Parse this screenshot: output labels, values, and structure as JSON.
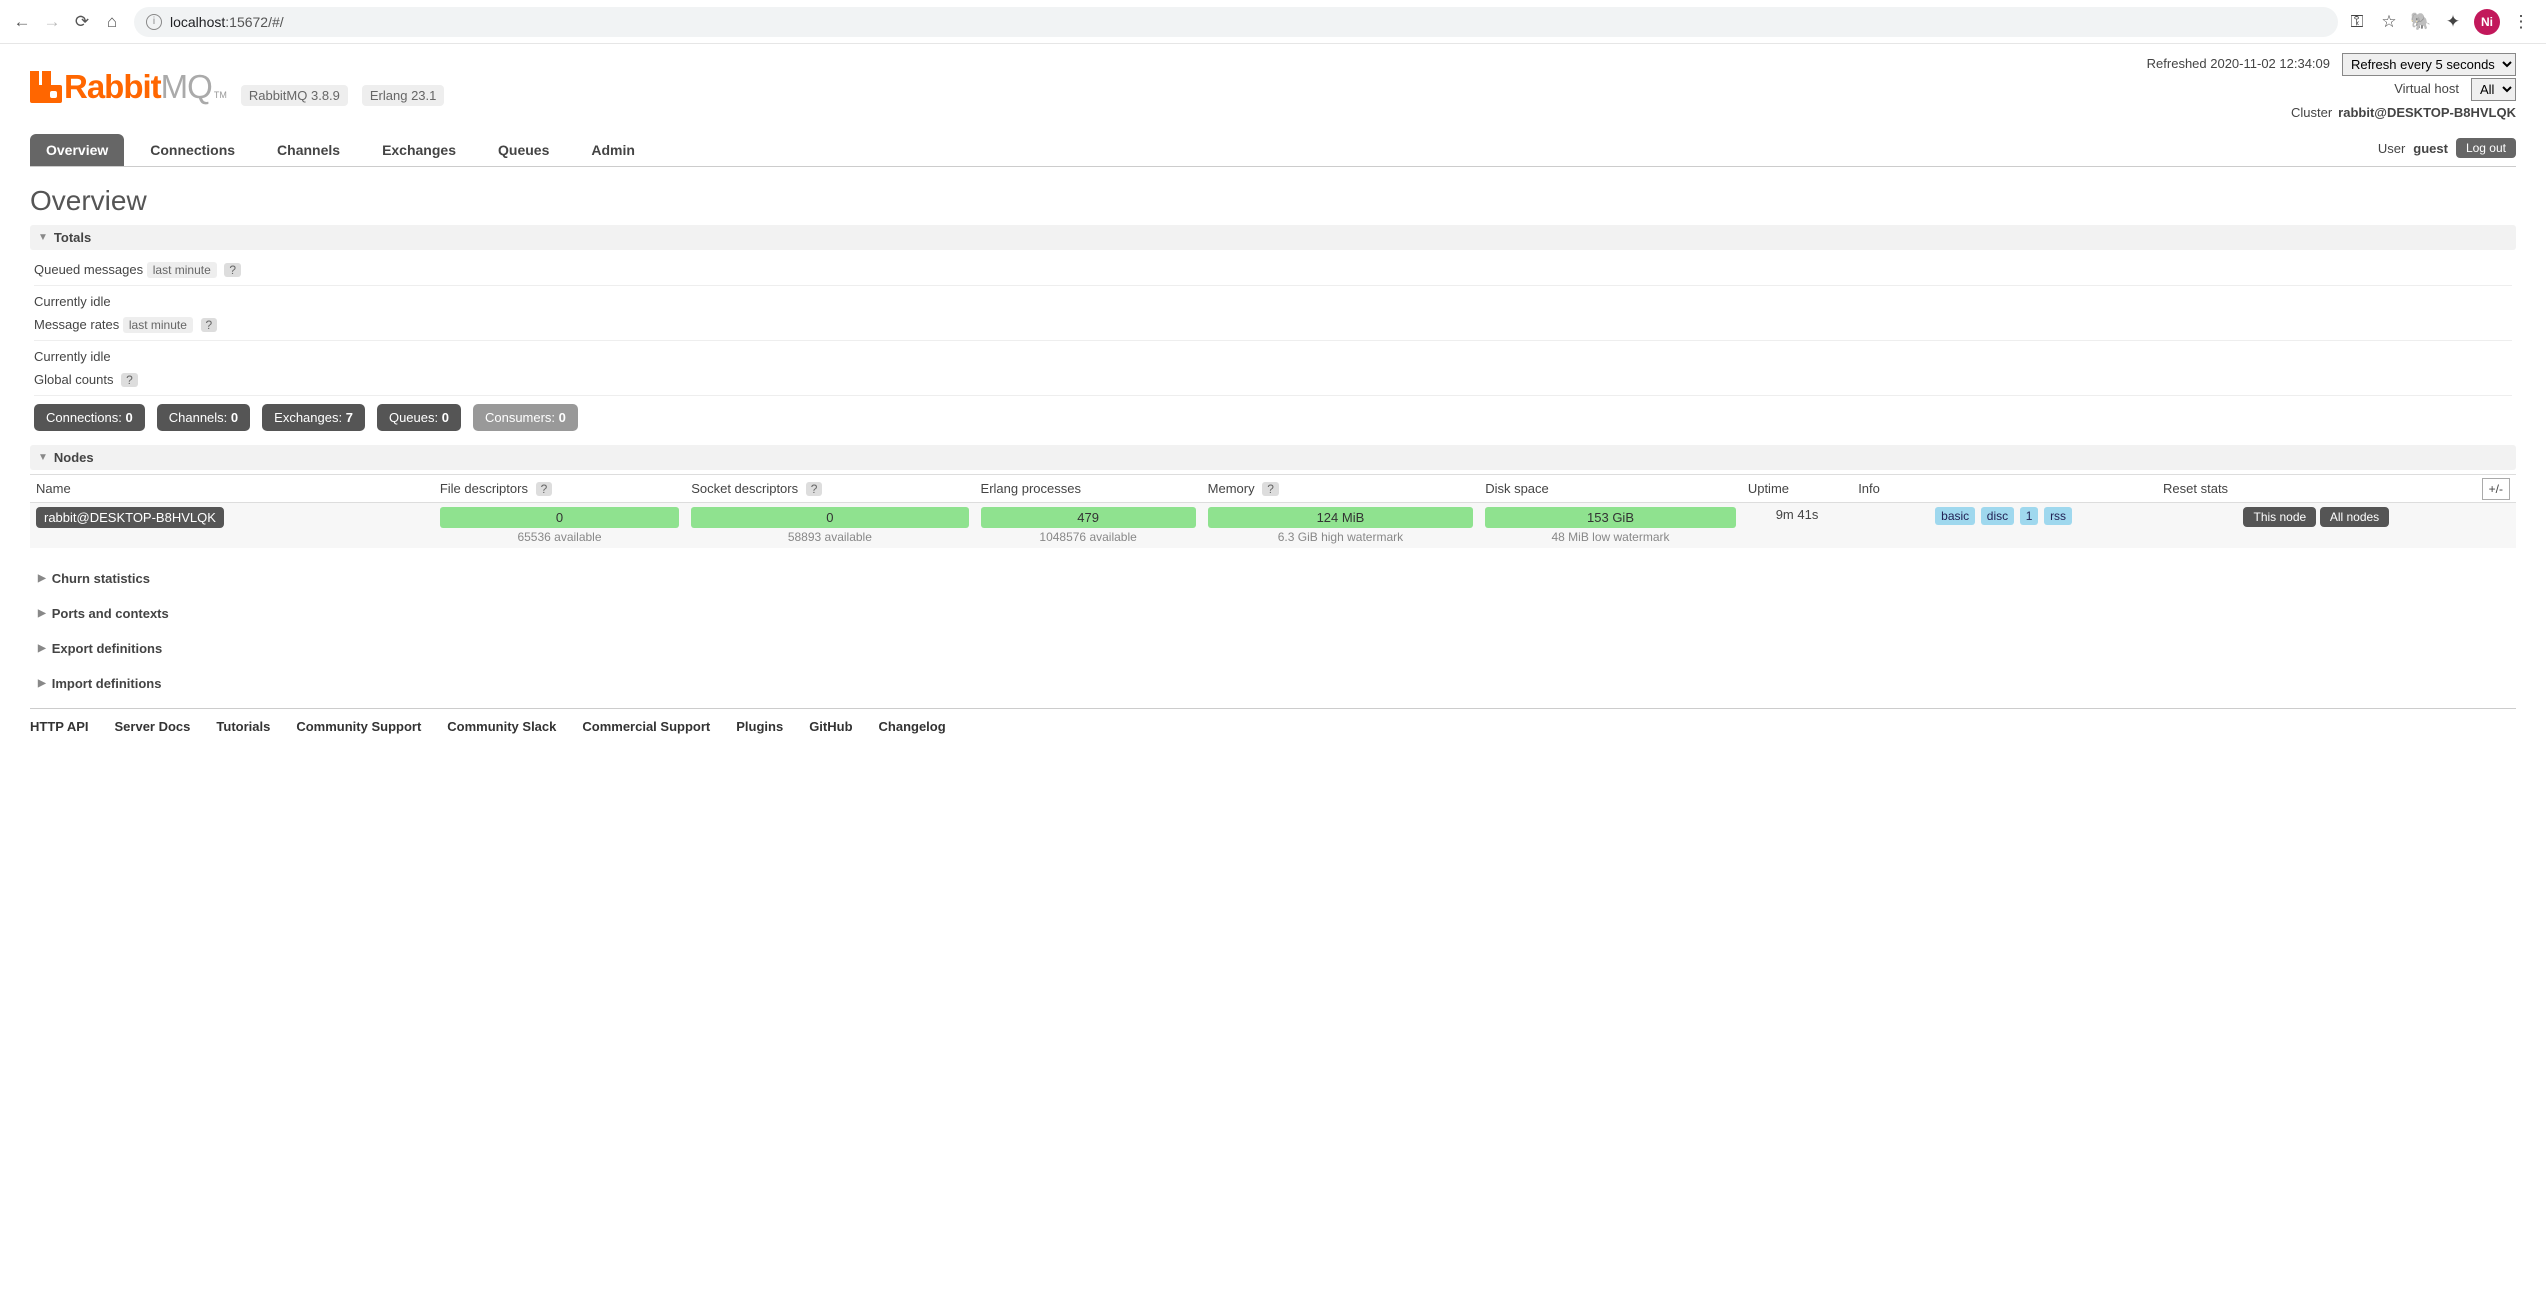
{
  "browser": {
    "url_host": "localhost",
    "url_rest": ":15672/#/",
    "avatar_initials": "Ni"
  },
  "header": {
    "logo_orange": "Rabbit",
    "logo_grey": "MQ",
    "tm": "TM",
    "version_rmq": "RabbitMQ 3.8.9",
    "version_erlang": "Erlang 23.1",
    "refreshed_label": "Refreshed 2020-11-02 12:34:09",
    "refresh_select": "Refresh every 5 seconds",
    "vhost_label": "Virtual host",
    "vhost_value": "All",
    "cluster_label": "Cluster",
    "cluster_name": "rabbit@DESKTOP-B8HVLQK",
    "user_label": "User",
    "user_name": "guest",
    "logout": "Log out"
  },
  "tabs": [
    "Overview",
    "Connections",
    "Channels",
    "Exchanges",
    "Queues",
    "Admin"
  ],
  "page_title": "Overview",
  "totals": {
    "title": "Totals",
    "queued_label": "Queued messages",
    "queued_range": "last minute",
    "idle1": "Currently idle",
    "rates_label": "Message rates",
    "rates_range": "last minute",
    "idle2": "Currently idle",
    "global_label": "Global counts"
  },
  "counts": [
    {
      "label": "Connections:",
      "value": "0",
      "light": false
    },
    {
      "label": "Channels:",
      "value": "0",
      "light": false
    },
    {
      "label": "Exchanges:",
      "value": "7",
      "light": false
    },
    {
      "label": "Queues:",
      "value": "0",
      "light": false
    },
    {
      "label": "Consumers:",
      "value": "0",
      "light": true
    }
  ],
  "nodes": {
    "title": "Nodes",
    "columns": [
      "Name",
      "File descriptors",
      "Socket descriptors",
      "Erlang processes",
      "Memory",
      "Disk space",
      "Uptime",
      "Info",
      "Reset stats",
      "+/-"
    ],
    "row": {
      "name": "rabbit@DESKTOP-B8HVLQK",
      "fd": "0",
      "fd_sub": "65536 available",
      "sd": "0",
      "sd_sub": "58893 available",
      "ep": "479",
      "ep_sub": "1048576 available",
      "mem": "124 MiB",
      "mem_sub": "6.3 GiB high watermark",
      "disk": "153 GiB",
      "disk_sub": "48 MiB low watermark",
      "uptime": "9m 41s",
      "info_tags": [
        "basic",
        "disc",
        "1",
        "rss"
      ],
      "reset_this": "This node",
      "reset_all": "All nodes"
    }
  },
  "collapsed_sections": [
    "Churn statistics",
    "Ports and contexts",
    "Export definitions",
    "Import definitions"
  ],
  "footer_links": [
    "HTTP API",
    "Server Docs",
    "Tutorials",
    "Community Support",
    "Community Slack",
    "Commercial Support",
    "Plugins",
    "GitHub",
    "Changelog"
  ]
}
